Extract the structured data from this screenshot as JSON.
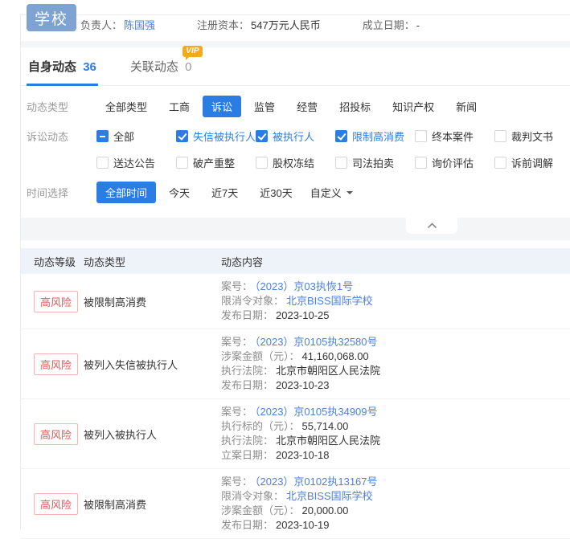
{
  "colors": {
    "accent": "#2b7ce3",
    "link": "#4e80d9",
    "risk": "#e05b5b",
    "risk-border": "#f2b5b5",
    "vip": "#f6a821",
    "logo": "#7ea3d3",
    "band": "#f4f5f7",
    "thead": "#eef3f9"
  },
  "header": {
    "logo_text": "学校",
    "fields": [
      {
        "label": "负责人：",
        "value": "陈国强",
        "link": true
      },
      {
        "label": "注册资本：",
        "value": "547万元人民币",
        "link": false
      },
      {
        "label": "成立日期：",
        "value": "-",
        "link": false
      }
    ]
  },
  "tabs": {
    "self": {
      "label": "自身动态",
      "count": "36"
    },
    "related": {
      "label": "关联动态",
      "count": "0",
      "vip": "VIP"
    }
  },
  "filters": {
    "type": {
      "label": "动态类型",
      "selected": "诉讼",
      "options": [
        "全部类型",
        "工商",
        "诉讼",
        "监管",
        "经营",
        "招投标",
        "知识产权",
        "新闻"
      ]
    },
    "litigation": {
      "label": "诉讼动态",
      "options": [
        {
          "label": "全部",
          "state": "indeterminate"
        },
        {
          "label": "失信被执行人",
          "state": "checked"
        },
        {
          "label": "被执行人",
          "state": "checked"
        },
        {
          "label": "限制高消费",
          "state": "checked"
        },
        {
          "label": "终本案件",
          "state": "unchecked"
        },
        {
          "label": "裁判文书",
          "state": "unchecked"
        },
        {
          "label": "送达公告",
          "state": "unchecked"
        },
        {
          "label": "破产重整",
          "state": "unchecked"
        },
        {
          "label": "股权冻结",
          "state": "unchecked"
        },
        {
          "label": "司法拍卖",
          "state": "unchecked"
        },
        {
          "label": "询价评估",
          "state": "unchecked"
        },
        {
          "label": "诉前调解",
          "state": "unchecked"
        }
      ]
    },
    "time": {
      "label": "时间选择",
      "selected": "全部时间",
      "options": [
        "全部时间",
        "今天",
        "近7天",
        "近30天"
      ],
      "custom": "自定义"
    }
  },
  "table": {
    "headers": [
      "动态等级",
      "动态类型",
      "动态内容"
    ],
    "rows": [
      {
        "level": "高风险",
        "type": "被限制高消费",
        "content": [
          {
            "label": "案号：",
            "value": "（2023）京03执恢1号",
            "link": true
          },
          {
            "label": "限消令对象：",
            "value": "北京BISS国际学校",
            "link": true
          },
          {
            "label": "发布日期：",
            "value": "2023-10-25",
            "link": false
          }
        ]
      },
      {
        "level": "高风险",
        "type": "被列入失信被执行人",
        "content": [
          {
            "label": "案号：",
            "value": "（2023）京0105执32580号",
            "link": true
          },
          {
            "label": "涉案金额（元）：",
            "value": "41,160,068.00",
            "link": false
          },
          {
            "label": "执行法院：",
            "value": "北京市朝阳区人民法院",
            "link": false
          },
          {
            "label": "发布日期：",
            "value": "2023-10-23",
            "link": false
          }
        ]
      },
      {
        "level": "高风险",
        "type": "被列入被执行人",
        "content": [
          {
            "label": "案号：",
            "value": "（2023）京0105执34909号",
            "link": true
          },
          {
            "label": "执行标的（元）：",
            "value": "55,714.00",
            "link": false
          },
          {
            "label": "执行法院：",
            "value": "北京市朝阳区人民法院",
            "link": false
          },
          {
            "label": "立案日期：",
            "value": "2023-10-18",
            "link": false
          }
        ]
      },
      {
        "level": "高风险",
        "type": "被限制高消费",
        "content": [
          {
            "label": "案号：",
            "value": "（2023）京0102执13167号",
            "link": true
          },
          {
            "label": "限消令对象：",
            "value": "北京BISS国际学校",
            "link": true
          },
          {
            "label": "涉案金额（元）：",
            "value": "20,000.00",
            "link": false
          },
          {
            "label": "发布日期：",
            "value": "2023-10-19",
            "link": false
          }
        ]
      }
    ]
  }
}
